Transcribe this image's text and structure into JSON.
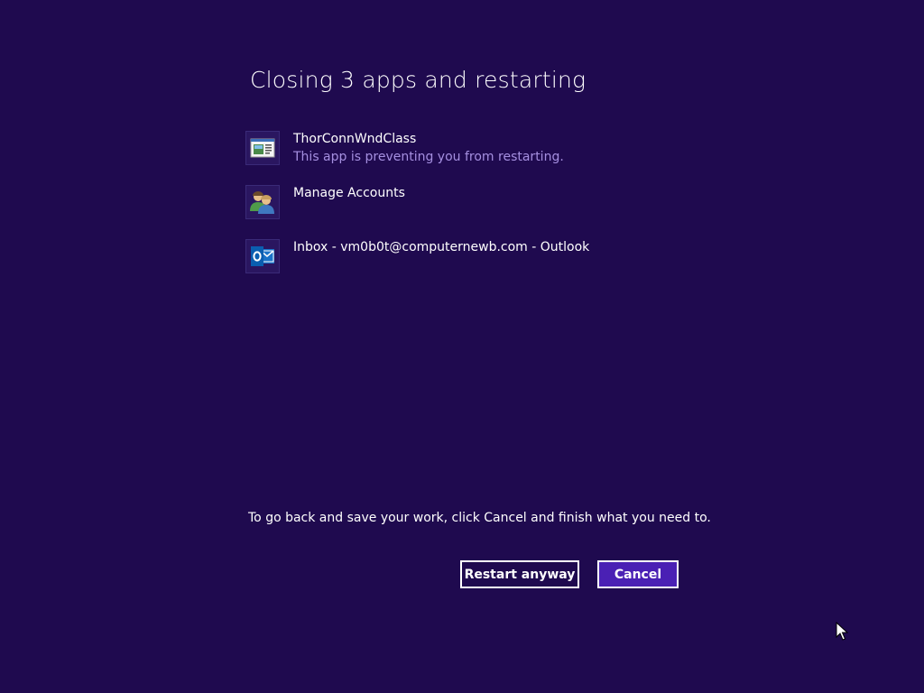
{
  "dialog": {
    "title": "Closing 3 apps and restarting",
    "apps": [
      {
        "name": "ThorConnWndClass",
        "subtitle": "This app is preventing you from restarting.",
        "icon": "window-app-icon"
      },
      {
        "name": "Manage Accounts",
        "subtitle": "",
        "icon": "users-icon"
      },
      {
        "name": "Inbox - vm0b0t@computernewb.com - Outlook",
        "subtitle": "",
        "icon": "outlook-icon"
      }
    ],
    "hint": "To go back and save your work, click Cancel and finish what you need to.",
    "restart_label": "Restart anyway",
    "cancel_label": "Cancel"
  },
  "colors": {
    "background": "#1f0a4f",
    "accent": "#4a20b4",
    "subtitle": "#a58fe0"
  }
}
